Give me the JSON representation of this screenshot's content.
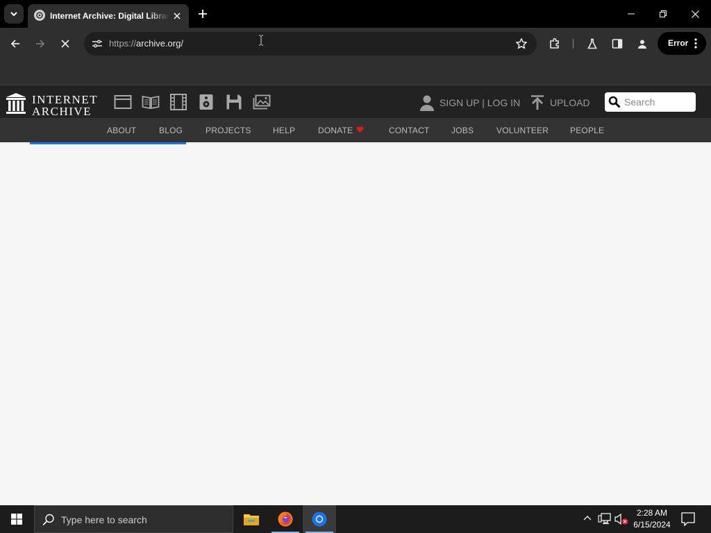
{
  "browser": {
    "tab": {
      "title": "Internet Archive: Digital Library of Free & Borrowable Books, Movies, Music & Wayback Machine"
    },
    "omnibox": {
      "scheme": "https://",
      "host": "archive.org/"
    },
    "error_button_label": "Error"
  },
  "ia": {
    "logo_line1": "INTERNET",
    "logo_line2": "ARCHIVE",
    "signup_label": "SIGN UP | LOG IN",
    "upload_label": "UPLOAD",
    "search_placeholder": "Search",
    "nav": [
      {
        "label": "ABOUT"
      },
      {
        "label": "BLOG"
      },
      {
        "label": "PROJECTS"
      },
      {
        "label": "HELP"
      },
      {
        "label": "DONATE"
      },
      {
        "label": "CONTACT"
      },
      {
        "label": "JOBS"
      },
      {
        "label": "VOLUNTEER"
      },
      {
        "label": "PEOPLE"
      }
    ],
    "media_icons": [
      "web-icon",
      "texts-icon",
      "video-icon",
      "audio-icon",
      "software-icon",
      "images-icon"
    ],
    "page_load_progress": 0.22
  },
  "taskbar": {
    "search_placeholder": "Type here to search",
    "time": "2:28 AM",
    "date": "6/15/2024",
    "apps": [
      "file-explorer-icon",
      "firefox-icon",
      "chrome-icon"
    ]
  },
  "colors": {
    "accent": "#1a73e8",
    "donate_heart": "#e0181e",
    "ia_header": "#222222",
    "ia_nav": "#333333"
  }
}
